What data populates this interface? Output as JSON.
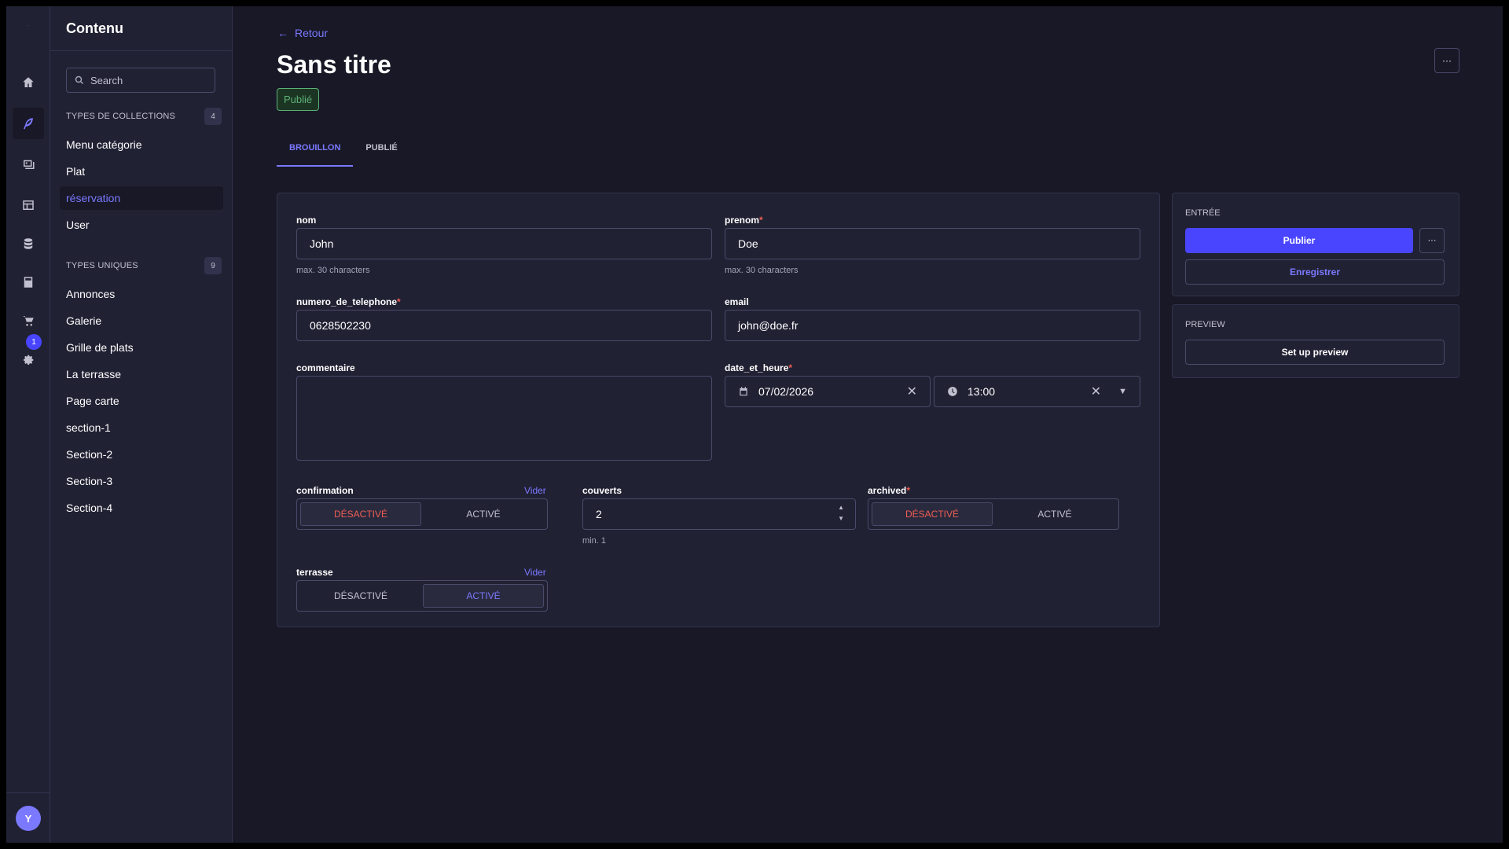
{
  "rail": {
    "logo_text": "-",
    "badge_count": "1",
    "avatar_initial": "Y"
  },
  "subnav": {
    "title": "Contenu",
    "search_placeholder": "Search",
    "collections": {
      "heading": "TYPES DE COLLECTIONS",
      "count": "4",
      "items": [
        "Menu catégorie",
        "Plat",
        "réservation",
        "User"
      ]
    },
    "singles": {
      "heading": "TYPES UNIQUES",
      "count": "9",
      "items": [
        "Annonces",
        "Galerie",
        "Grille de plats",
        "La terrasse",
        "Page carte",
        "section-1",
        "Section-2",
        "Section-3",
        "Section-4"
      ]
    }
  },
  "header": {
    "back_label": "Retour",
    "title": "Sans titre",
    "status": "Publié",
    "more_label": "···"
  },
  "tabs": [
    {
      "label": "BROUILLON"
    },
    {
      "label": "PUBLIÉ"
    }
  ],
  "form": {
    "nom": {
      "label": "nom",
      "value": "John",
      "hint": "max. 30 characters"
    },
    "prenom": {
      "label": "prenom",
      "value": "Doe",
      "hint": "max. 30 characters",
      "required": "*"
    },
    "telephone": {
      "label": "numero_de_telephone",
      "value": "0628502230",
      "required": "*"
    },
    "email": {
      "label": "email",
      "value": "john@doe.fr"
    },
    "commentaire": {
      "label": "commentaire",
      "value": ""
    },
    "date_et_heure": {
      "label": "date_et_heure",
      "date": "07/02/2026",
      "time": "13:00",
      "required": "*"
    },
    "confirmation": {
      "label": "confirmation",
      "clear": "Vider",
      "off": "DÉSACTIVÉ",
      "on": "ACTIVÉ"
    },
    "couverts": {
      "label": "couverts",
      "value": "2",
      "hint": "min. 1"
    },
    "archived": {
      "label": "archived",
      "required": "*",
      "off": "DÉSACTIVÉ",
      "on": "ACTIVÉ"
    },
    "terrasse": {
      "label": "terrasse",
      "clear": "Vider",
      "off": "DÉSACTIVÉ",
      "on": "ACTIVÉ"
    }
  },
  "entry_panel": {
    "title": "ENTRÉE",
    "publish": "Publier",
    "more": "···",
    "save": "Enregistrer"
  },
  "preview_panel": {
    "title": "PREVIEW",
    "setup": "Set up preview"
  },
  "colors": {
    "accent": "#7b79ff",
    "primary": "#4945ff",
    "danger": "#ee5e52",
    "success": "#5cb176"
  }
}
